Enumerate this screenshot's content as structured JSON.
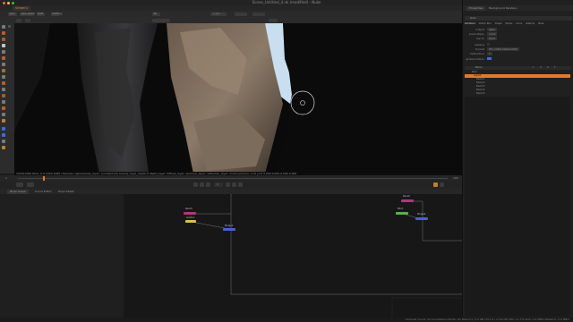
{
  "window": {
    "title": "Scene_Untitled_4.nk (modified) - Nuke",
    "traffic_lights": [
      "#ff5f57",
      "#febc2e",
      "#28c840"
    ]
  },
  "viewer_tabs": [
    "Viewer1"
  ],
  "toolbar": {
    "channels": "rgba",
    "channel_mode": "rgba.alpha",
    "colorspace": "RGB",
    "zoom": "1.2:1",
    "proxy": "3D",
    "layer": "ACEScg"
  },
  "viewer": {
    "info_line": "1920x1080 bbox: 0 0 1920 1080 channels: rgba beauty_layer: (unmatched) beauty_layer_depth.Z depth_layer: diffuse_layer: specular_layer: reflection_layer: motionvectors: x=0 y=0 0.000 0.000 0.000 0.000",
    "cursor_icon": "circle-cursor"
  },
  "timeline": {
    "start": "1",
    "end": "100",
    "current": "1"
  },
  "node_graph": {
    "tabs": [
      "Node Graph",
      "Curve Editor",
      "Dope Sheet"
    ],
    "nodes": [
      {
        "name": "Read1",
        "color": "#b0367a"
      },
      {
        "name": "Grade1",
        "color": "#d6c24a"
      },
      {
        "name": "Merge1",
        "color": "#4a5fd0"
      },
      {
        "name": "Read2",
        "color": "#b0367a"
      },
      {
        "name": "Blur1",
        "color": "#58b24a"
      },
      {
        "name": "Merge2",
        "color": "#4a5fd0"
      }
    ]
  },
  "right_panel": {
    "tabs": [
      "Properties",
      "Background Renders"
    ],
    "section": "Roto",
    "subtabs": [
      "RotoPaint",
      "Motion Blur",
      "Shape",
      "Stroke",
      "Clone",
      "Lifetime",
      "Node"
    ],
    "rows": [
      {
        "label": "output",
        "value": "rgba"
      },
      {
        "label": "premultiply",
        "value": "none"
      },
      {
        "label": "clip to",
        "value": "bbox"
      },
      {
        "label": "replace",
        "value": ""
      },
      {
        "label": "format",
        "value": "HD_1080 1920x1080"
      },
      {
        "label": "motionblur",
        "value": "1"
      },
      {
        "label": "global motion",
        "value": ""
      }
    ],
    "layers_header": [
      "Name",
      "L",
      "V",
      "C",
      "F"
    ],
    "layers": [
      {
        "name": "Root",
        "selected": false
      },
      {
        "name": "Layer1",
        "selected": true
      },
      {
        "name": "Bezier1",
        "selected": false
      },
      {
        "name": "Bezier2",
        "selected": false
      },
      {
        "name": "Bezier3",
        "selected": false
      },
      {
        "name": "Bezier4",
        "selected": false
      },
      {
        "name": "Bezier5",
        "selected": false
      }
    ]
  },
  "status": "Channel Count: 24 Localization Mode: On Memory: 5.3 GB (33.1%) of 16 GB CPU: 12.7% Disk: 0.0 MB/s Network: 0.0 MB/s"
}
